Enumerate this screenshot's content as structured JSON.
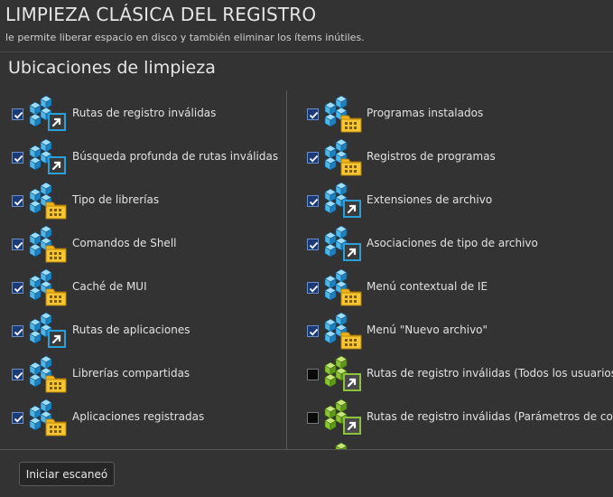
{
  "header": {
    "title": "LIMPIEZA CLÁSICA DEL REGISTRO",
    "subtitle": "le permite liberar espacio en disco y también eliminar los ítems inútiles."
  },
  "section": {
    "title": "Ubicaciones de limpieza"
  },
  "colors": {
    "blue": "#2a9fd8",
    "green": "#7ab51d",
    "folder": "#f2b318",
    "checkbox": "#1b3a78"
  },
  "left_items": [
    {
      "label": "Rutas de registro inválidas",
      "checked": true,
      "icon": "registry-shortcut-icon",
      "color": "blue",
      "badge": "shortcut"
    },
    {
      "label": "Búsqueda profunda de rutas inválidas",
      "checked": true,
      "icon": "registry-shortcut-icon",
      "color": "blue",
      "badge": "shortcut"
    },
    {
      "label": "Tipo de librerías",
      "checked": true,
      "icon": "registry-folder-icon",
      "color": "blue",
      "badge": "folder"
    },
    {
      "label": "Comandos de Shell",
      "checked": true,
      "icon": "registry-folder-icon",
      "color": "blue",
      "badge": "folder"
    },
    {
      "label": "Caché de MUI",
      "checked": true,
      "icon": "registry-folder-icon",
      "color": "blue",
      "badge": "folder"
    },
    {
      "label": "Rutas de aplicaciones",
      "checked": true,
      "icon": "registry-shortcut-icon",
      "color": "blue",
      "badge": "shortcut"
    },
    {
      "label": "Librerías compartidas",
      "checked": true,
      "icon": "registry-folder-icon",
      "color": "blue",
      "badge": "folder"
    },
    {
      "label": "Aplicaciones registradas",
      "checked": true,
      "icon": "registry-folder-icon",
      "color": "blue",
      "badge": "folder"
    },
    {
      "label": "",
      "checked": null,
      "icon": "gear-icon",
      "color": "gray",
      "badge": "none"
    }
  ],
  "right_items": [
    {
      "label": "Programas instalados",
      "checked": true,
      "icon": "registry-folder-icon",
      "color": "blue",
      "badge": "folder"
    },
    {
      "label": "Registros de programas",
      "checked": true,
      "icon": "registry-folder-icon",
      "color": "blue",
      "badge": "folder"
    },
    {
      "label": "Extensiones de archivo",
      "checked": true,
      "icon": "registry-shortcut-icon",
      "color": "blue",
      "badge": "shortcut"
    },
    {
      "label": "Asociaciones de tipo de archivo",
      "checked": true,
      "icon": "registry-shortcut-icon",
      "color": "blue",
      "badge": "shortcut"
    },
    {
      "label": "Menú contextual de IE",
      "checked": true,
      "icon": "registry-folder-icon",
      "color": "blue",
      "badge": "folder"
    },
    {
      "label": "Menú \"Nuevo archivo\"",
      "checked": true,
      "icon": "registry-folder-icon",
      "color": "blue",
      "badge": "folder"
    },
    {
      "label": "Rutas de registro inválidas (Todos los usuarios)",
      "checked": false,
      "icon": "registry-shortcut-icon",
      "color": "green",
      "badge": "shortcut"
    },
    {
      "label": "Rutas de registro inválidas (Parámetros de control)",
      "checked": false,
      "icon": "registry-shortcut-icon",
      "color": "green",
      "badge": "shortcut"
    },
    {
      "label": "",
      "checked": null,
      "icon": "registry-icon",
      "color": "green",
      "badge": "none"
    }
  ],
  "footer": {
    "scan_button": "Iniciar escaneó"
  }
}
